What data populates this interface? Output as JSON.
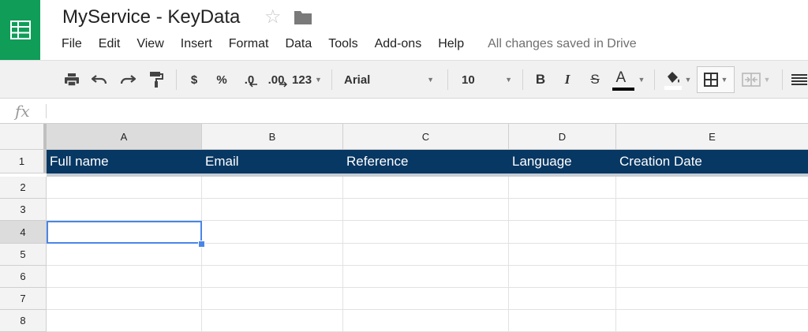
{
  "document": {
    "title": "MyService - KeyData"
  },
  "menu": {
    "items": [
      "File",
      "Edit",
      "View",
      "Insert",
      "Format",
      "Data",
      "Tools",
      "Add-ons",
      "Help"
    ],
    "save_status": "All changes saved in Drive"
  },
  "toolbar": {
    "currency": "$",
    "percent": "%",
    "decrease_decimals": ".0",
    "increase_decimals": ".00",
    "more_formats": "123",
    "font": "Arial",
    "font_size": "10",
    "bold": "B",
    "italic": "I",
    "strikethrough": "S",
    "text_color": "A",
    "text_color_hex": "#000000"
  },
  "formula_bar": {
    "icon_label": "fx",
    "value": ""
  },
  "grid": {
    "columns": [
      "A",
      "B",
      "C",
      "D",
      "E"
    ],
    "rows": [
      "1",
      "2",
      "3",
      "4",
      "5",
      "6",
      "7",
      "8"
    ],
    "header_fill": "#073763",
    "header_text_color": "#ffffff",
    "row1": [
      "Full name",
      "Email",
      "Reference",
      "Language",
      "Creation Date"
    ],
    "selected_cell": "A4",
    "selection_color": "#4a86e8"
  },
  "colors": {
    "brand": "#0f9d58"
  }
}
